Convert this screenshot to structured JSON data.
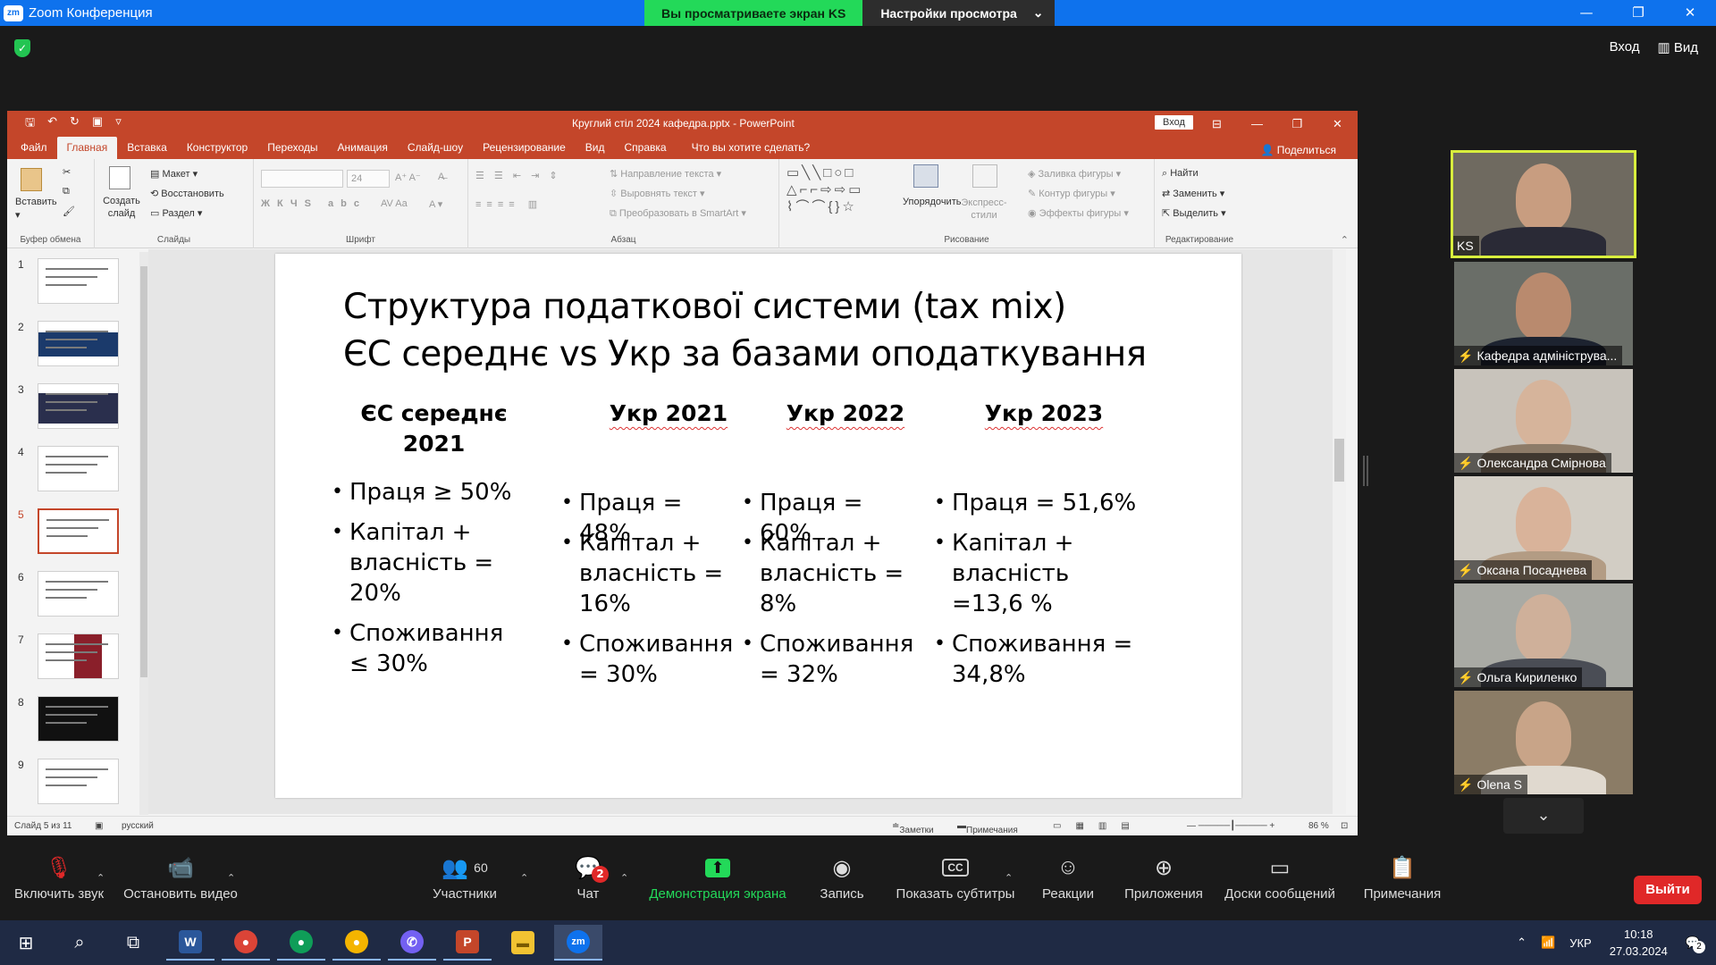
{
  "zoom": {
    "app_title": "Zoom Конференция",
    "logo": "zm",
    "viewing_banner": "Вы просматриваете экран KS",
    "view_settings": "Настройки просмотра",
    "login": "Вход",
    "view": "Вид",
    "colors": {
      "brand": "#0e72ed",
      "banner_green": "#23d959",
      "leave": "#e02828"
    }
  },
  "ppt": {
    "title": "Круглий стіл 2024 кафедра.pptx  -  PowerPoint",
    "login": "Вход",
    "share": "Поделиться",
    "tabs": [
      "Файл",
      "Главная",
      "Вставка",
      "Конструктор",
      "Переходы",
      "Анимация",
      "Слайд-шоу",
      "Рецензирование",
      "Вид",
      "Справка",
      "Что вы хотите сделать?"
    ],
    "active_tab": "Главная",
    "ribbon": {
      "clipboard": {
        "paste": "Вставить",
        "label": "Буфер обмена"
      },
      "slides": {
        "new_slide": "Создать слайд",
        "layout": "Макет",
        "reset": "Восстановить",
        "section": "Раздел",
        "label": "Слайды"
      },
      "font": {
        "size": "24",
        "label": "Шрифт"
      },
      "paragraph": {
        "text_direction": "Направление текста",
        "align_text": "Выровнять текст",
        "smartart": "Преобразовать в SmartArt",
        "label": "Абзац"
      },
      "drawing": {
        "arrange": "Упорядочить",
        "quick_styles": "Экспресс-стили",
        "shape_fill": "Заливка фигуры",
        "shape_outline": "Контур фигуры",
        "shape_effects": "Эффекты фигуры",
        "label": "Рисование"
      },
      "editing": {
        "find": "Найти",
        "replace": "Заменить",
        "select": "Выделить",
        "label": "Редактирование"
      }
    },
    "thumbnails": [
      "1",
      "2",
      "3",
      "4",
      "5",
      "6",
      "7",
      "8",
      "9"
    ],
    "selected_thumbnail": "5",
    "status": {
      "slide": "Слайд 5 из 11",
      "language": "русский",
      "notes": "Заметки",
      "comments": "Примечания",
      "zoom": "86 %"
    }
  },
  "slide": {
    "title_line1": "Структура податкової системи (tax mix)",
    "title_line2": "ЄС середнє vs Укр за базами оподаткування",
    "columns": [
      {
        "head": "ЄС середнє 2021",
        "items": [
          "Праця ≥ 50%",
          "Капітал + власність = 20%",
          "Споживання ≤ 30%"
        ]
      },
      {
        "head": "Укр 2021",
        "items": [
          "Праця = 48%",
          "Капітал + власність = 16%",
          "Споживання = 30%"
        ]
      },
      {
        "head": "Укр 2022",
        "items": [
          "Праця = 60%",
          "Капітал + власність = 8%",
          "Споживання = 32%"
        ]
      },
      {
        "head": "Укр 2023",
        "items": [
          "Праця = 51,6%",
          "Капітал + власність =13,6 %",
          "Споживання = 34,8%"
        ]
      }
    ]
  },
  "participants": [
    {
      "name": "KS",
      "active": true
    },
    {
      "name": "Кафедра адмініструва..."
    },
    {
      "name": "Олександра Смірнова"
    },
    {
      "name": "Оксана Посаднева"
    },
    {
      "name": "Ольга Кириленко"
    },
    {
      "name": "Olena S"
    }
  ],
  "toolbar": {
    "unmute": "Включить звук",
    "stop_video": "Остановить видео",
    "participants": "Участники",
    "participants_count": "60",
    "chat": "Чат",
    "chat_badge": "2",
    "share_screen": "Демонстрация экрана",
    "record": "Запись",
    "captions": "Показать субтитры",
    "reactions": "Реакции",
    "apps": "Приложения",
    "whiteboards": "Доски сообщений",
    "notes": "Примечания",
    "leave": "Выйти"
  },
  "taskbar": {
    "language": "УКР",
    "time": "10:18",
    "date": "27.03.2024",
    "notifications": "2"
  }
}
